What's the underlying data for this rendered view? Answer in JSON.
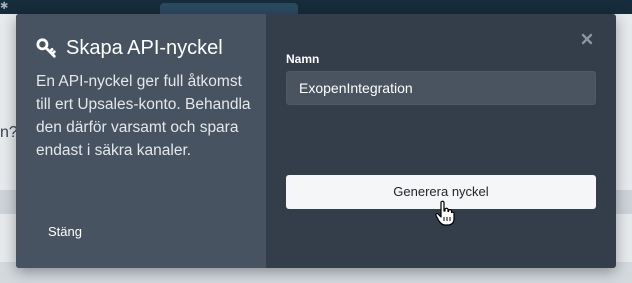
{
  "background": {
    "question_fragment": "n?"
  },
  "modal": {
    "title": "Skapa API-nyckel",
    "title_icon": "key-icon",
    "description": "En API-nyckel ger full åtkomst till ert Upsales-konto. Behandla den därför varsamt och spara endast i säkra kanaler.",
    "close_label": "Stäng",
    "close_icon": "close-icon",
    "name_field": {
      "label": "Namn",
      "value": "ExopenIntegration"
    },
    "generate_button": "Generera nyckel"
  },
  "colors": {
    "modal_bg": "#343d4a",
    "modal_left_bg": "#485361",
    "input_bg": "#4a5461",
    "button_bg": "#f5f6f7"
  }
}
